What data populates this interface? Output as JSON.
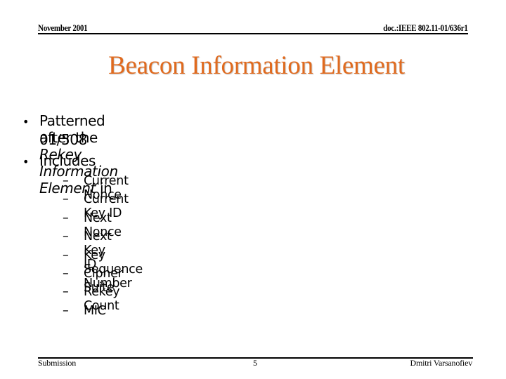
{
  "header": {
    "date": "November 2001",
    "doc_id": "doc.:IEEE 802.11-01/636r1"
  },
  "title": "Beacon Information Element",
  "colors": {
    "title": "#e06a1e",
    "text": "#000000"
  },
  "bullets": [
    {
      "line1_pre": "Patterned after the ",
      "line1_italic": "Rekey Information Element",
      "line1_post": "  in",
      "line2": "01/508"
    },
    {
      "text": "Includes"
    }
  ],
  "sub_bullets": [
    "Current Nonce",
    "Current Key ID",
    "Next Nonce",
    "Next Key ID",
    "Key Sequence Number",
    "Cipher Suite",
    "Rekey Count",
    "MIC"
  ],
  "sub_marker": "–",
  "bullet_marker": "•",
  "footer": {
    "left": "Submission",
    "center": "5",
    "right": "Dmitri Varsanofiev"
  }
}
